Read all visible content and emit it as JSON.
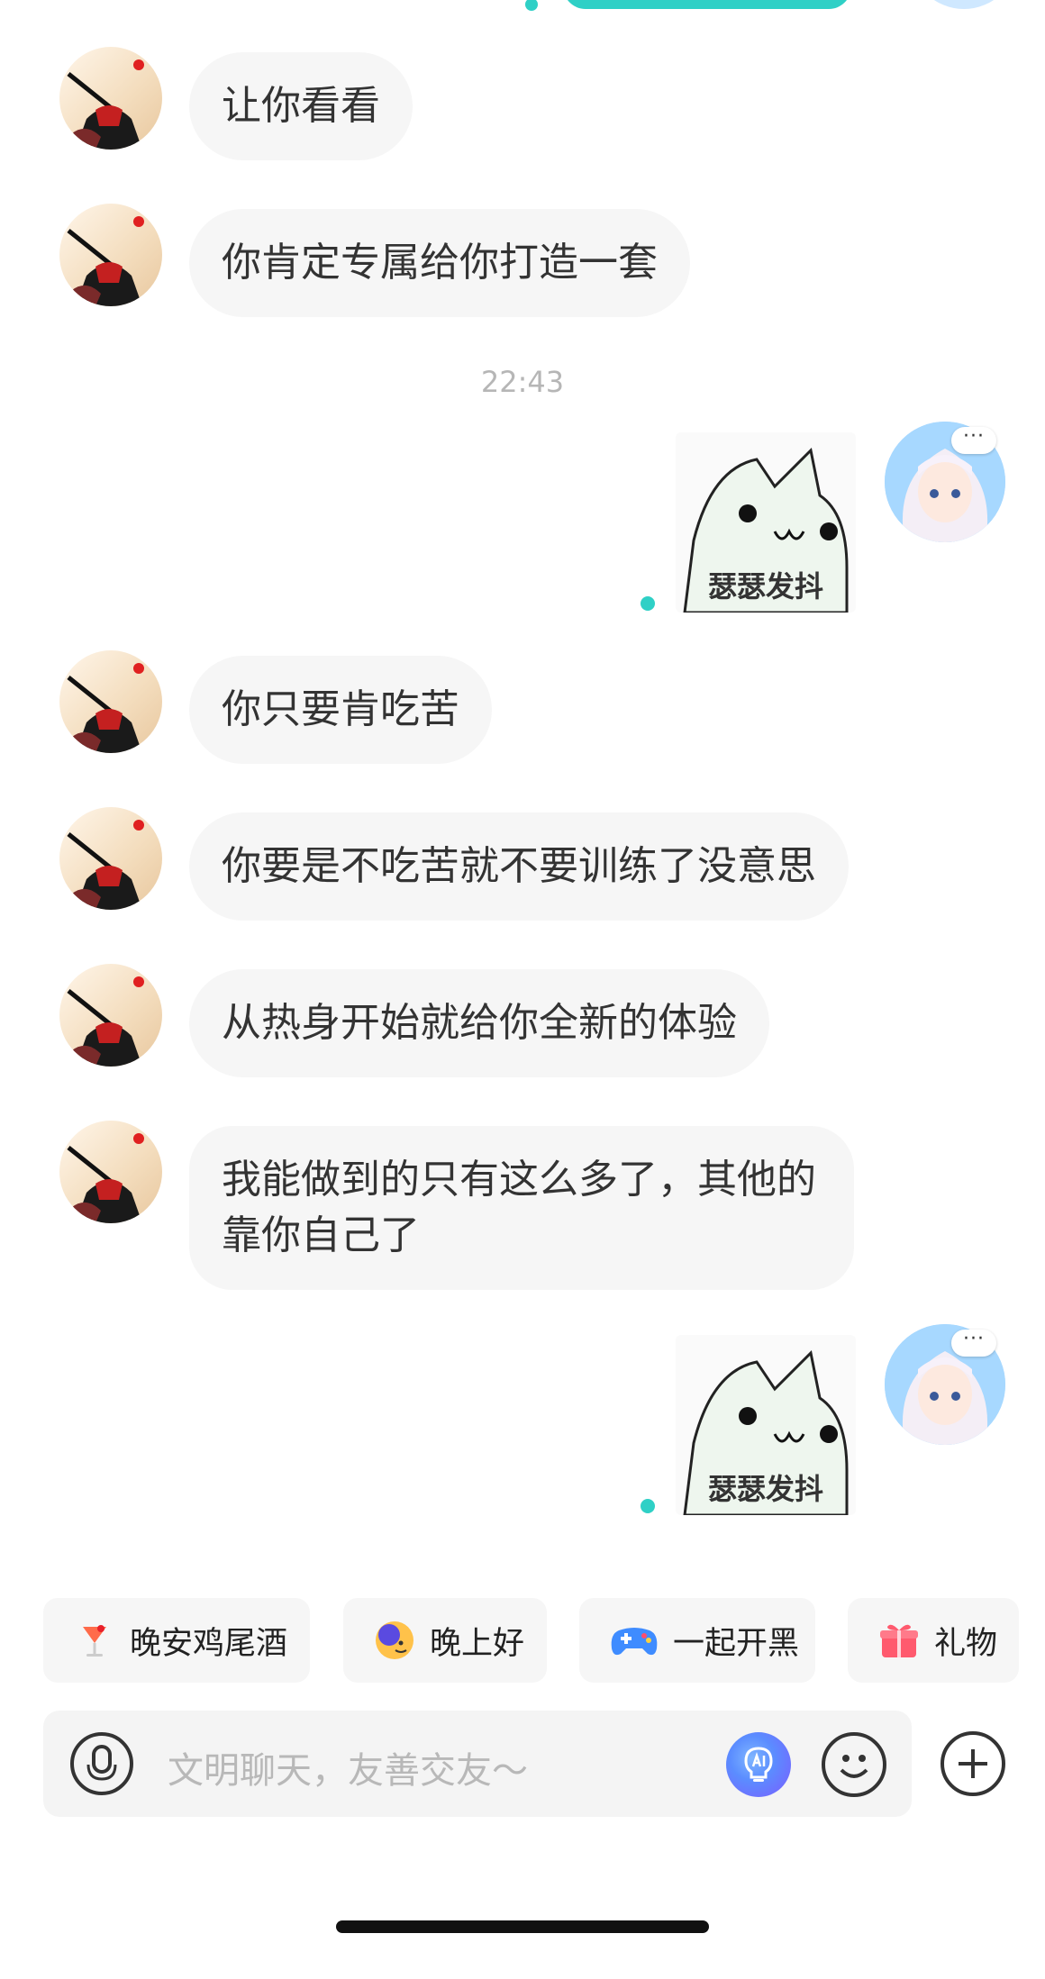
{
  "messages": [
    {
      "side": "left",
      "text": "让你看看"
    },
    {
      "side": "left",
      "text": "你肯定专属给你打造一套"
    },
    {
      "side": "left",
      "text": "你只要肯吃苦"
    },
    {
      "side": "left",
      "text": "你要是不吃苦就不要训练了没意思"
    },
    {
      "side": "left",
      "text": "从热身开始就给你全新的体验"
    },
    {
      "side": "left",
      "text": "我能做到的只有这么多了，其他的靠你自己了"
    }
  ],
  "timestamp": "22:43",
  "stickers": [
    {
      "caption": "瑟瑟发抖"
    },
    {
      "caption": "瑟瑟发抖"
    }
  ],
  "avatar_menu": "···",
  "quick_replies": [
    {
      "label": "晚安鸡尾酒",
      "icon": "cocktail-icon"
    },
    {
      "label": "晚上好",
      "icon": "moon-face-icon"
    },
    {
      "label": "一起开黑",
      "icon": "gamepad-icon"
    },
    {
      "label": "礼物",
      "icon": "gift-icon"
    }
  ],
  "input": {
    "placeholder": "文明聊天，友善交友～"
  },
  "colors": {
    "accent": "#2fd0c6",
    "bubble": "#f6f6f6"
  }
}
